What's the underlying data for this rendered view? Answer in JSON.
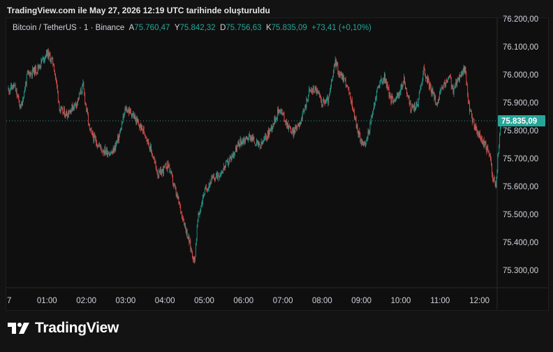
{
  "header": {
    "caption": "TradingView.com ile May 27, 2026 12:19 UTC tarihinde oluşturuldu"
  },
  "legend": {
    "symbol": "Bitcoin / TetherUS · 1 · Binance",
    "open_label": "A",
    "open_value": "75.760,47",
    "high_label": "Y",
    "high_value": "75.842,32",
    "low_label": "D",
    "low_value": "75.756,63",
    "close_label": "K",
    "close_value": "75.835,09",
    "change": "+73,41 (+0,10%)"
  },
  "colors": {
    "up": "#26a69a",
    "down": "#ef5350",
    "background": "#0f0f0f",
    "grid": "#1e1e1e",
    "axis_text": "#d1d4dc",
    "price_tag": "#26a69a"
  },
  "footer": {
    "brand": "TradingView",
    "logo_icon": "tradingview-logo-icon"
  },
  "chart_data": {
    "type": "candlestick",
    "symbol": "Bitcoin / TetherUS",
    "interval": "1",
    "exchange": "Binance",
    "last_price": 75835.09,
    "last_price_label": "75.835,09",
    "ylim": [
      75255,
      76230
    ],
    "y_ticks": [
      {
        "value": 76200,
        "label": "76.200,00"
      },
      {
        "value": 76100,
        "label": "76.100,00"
      },
      {
        "value": 76000,
        "label": "76.000,00"
      },
      {
        "value": 75900,
        "label": "75.900,00"
      },
      {
        "value": 75800,
        "label": "75.800,00"
      },
      {
        "value": 75700,
        "label": "75.700,00"
      },
      {
        "value": 75600,
        "label": "75.600,00"
      },
      {
        "value": 75500,
        "label": "75.500,00"
      },
      {
        "value": 75400,
        "label": "75.400,00"
      },
      {
        "value": 75300,
        "label": "75.300,00"
      }
    ],
    "x_ticks": [
      {
        "t": 0,
        "label": "7"
      },
      {
        "t": 60,
        "label": "01:00"
      },
      {
        "t": 120,
        "label": "02:00"
      },
      {
        "t": 180,
        "label": "03:00"
      },
      {
        "t": 240,
        "label": "04:00"
      },
      {
        "t": 300,
        "label": "05:00"
      },
      {
        "t": 360,
        "label": "06:00"
      },
      {
        "t": 420,
        "label": "07:00"
      },
      {
        "t": 480,
        "label": "08:00"
      },
      {
        "t": 540,
        "label": "09:00"
      },
      {
        "t": 600,
        "label": "10:00"
      },
      {
        "t": 660,
        "label": "11:00"
      },
      {
        "t": 720,
        "label": "12:00"
      }
    ],
    "grid": false,
    "close_path": [
      [
        0,
        75945
      ],
      [
        10,
        75960
      ],
      [
        20,
        75880
      ],
      [
        30,
        76000
      ],
      [
        45,
        76020
      ],
      [
        60,
        76080
      ],
      [
        70,
        76040
      ],
      [
        80,
        75870
      ],
      [
        90,
        75860
      ],
      [
        105,
        75900
      ],
      [
        115,
        75960
      ],
      [
        125,
        75800
      ],
      [
        135,
        75760
      ],
      [
        145,
        75730
      ],
      [
        160,
        75720
      ],
      [
        170,
        75780
      ],
      [
        180,
        75880
      ],
      [
        190,
        75860
      ],
      [
        200,
        75820
      ],
      [
        210,
        75790
      ],
      [
        220,
        75720
      ],
      [
        230,
        75640
      ],
      [
        245,
        75680
      ],
      [
        255,
        75590
      ],
      [
        265,
        75510
      ],
      [
        275,
        75420
      ],
      [
        285,
        75330
      ],
      [
        290,
        75480
      ],
      [
        300,
        75580
      ],
      [
        310,
        75620
      ],
      [
        325,
        75650
      ],
      [
        340,
        75700
      ],
      [
        355,
        75760
      ],
      [
        370,
        75780
      ],
      [
        385,
        75740
      ],
      [
        400,
        75800
      ],
      [
        415,
        75880
      ],
      [
        425,
        75830
      ],
      [
        435,
        75790
      ],
      [
        450,
        75850
      ],
      [
        460,
        75940
      ],
      [
        470,
        75950
      ],
      [
        480,
        75900
      ],
      [
        490,
        75910
      ],
      [
        500,
        76050
      ],
      [
        505,
        76010
      ],
      [
        515,
        75980
      ],
      [
        525,
        75900
      ],
      [
        535,
        75790
      ],
      [
        545,
        75740
      ],
      [
        555,
        75840
      ],
      [
        565,
        75960
      ],
      [
        575,
        75990
      ],
      [
        585,
        75910
      ],
      [
        595,
        75920
      ],
      [
        605,
        75980
      ],
      [
        615,
        75880
      ],
      [
        625,
        75890
      ],
      [
        635,
        76020
      ],
      [
        645,
        75950
      ],
      [
        655,
        75900
      ],
      [
        665,
        75960
      ],
      [
        675,
        75990
      ],
      [
        680,
        75940
      ],
      [
        690,
        76000
      ],
      [
        698,
        76020
      ],
      [
        705,
        75870
      ],
      [
        715,
        75800
      ],
      [
        725,
        75760
      ],
      [
        735,
        75720
      ],
      [
        740,
        75640
      ],
      [
        745,
        75600
      ],
      [
        748,
        75700
      ],
      [
        753,
        75835
      ]
    ]
  }
}
